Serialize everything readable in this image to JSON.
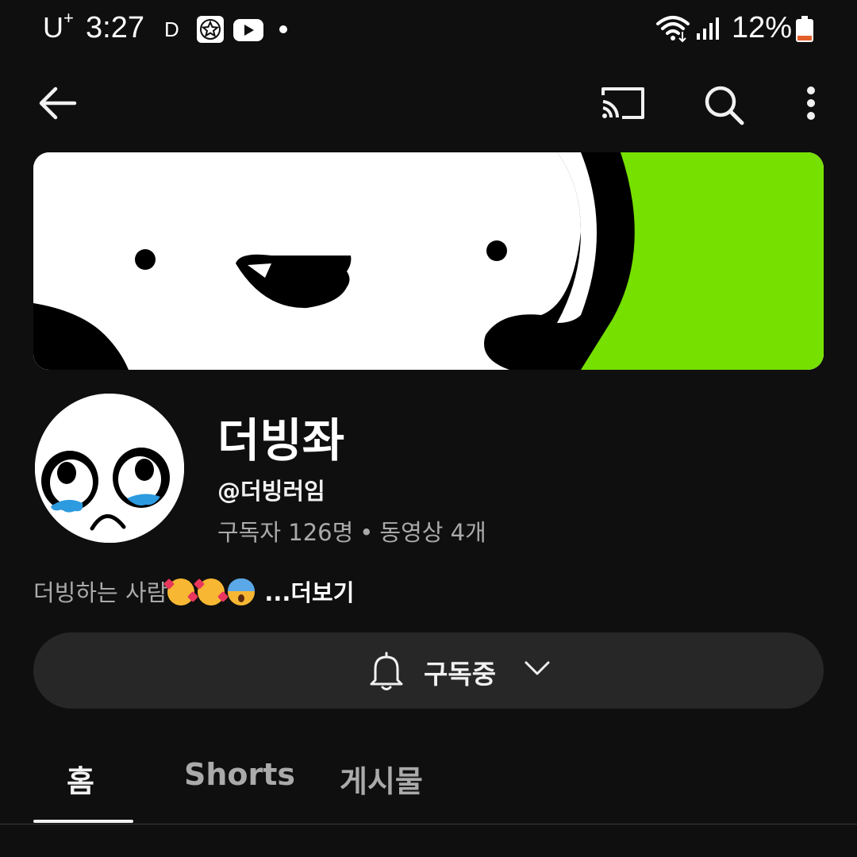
{
  "status_bar": {
    "carrier": "U",
    "carrier_sup": "+",
    "time": "3:27",
    "indicator": "D",
    "battery": "12%",
    "icons": [
      "star-app-icon",
      "youtube-icon",
      "notification-dot-icon",
      "wifi-icon",
      "signal-icon",
      "battery-icon"
    ]
  },
  "top_bar": {
    "icons": [
      "back-arrow-icon",
      "cast-icon",
      "search-icon",
      "more-vert-icon"
    ]
  },
  "channel": {
    "name": "더빙좌",
    "handle": "@더빙러임",
    "subscribers": "구독자 126명",
    "separator": "•",
    "videos": "동영상 4개",
    "description": "더빙하는 사람",
    "description_emojis": [
      "smiling-face-with-hearts",
      "smiling-face-with-hearts",
      "face-screaming-in-fear"
    ],
    "more": "...더보기"
  },
  "subscribe": {
    "label": "구독중",
    "icons": [
      "bell-icon",
      "chevron-down-icon"
    ]
  },
  "tabs": [
    {
      "label": "홈",
      "selected": true
    },
    {
      "label": "Shorts",
      "selected": false
    },
    {
      "label": "게시물",
      "selected": false
    }
  ],
  "colors": {
    "background": "#0f0f0f",
    "surface": "#272727",
    "text_primary": "#f1f1f1",
    "text_secondary": "#aaaaaa",
    "banner_green": "#76e000"
  }
}
